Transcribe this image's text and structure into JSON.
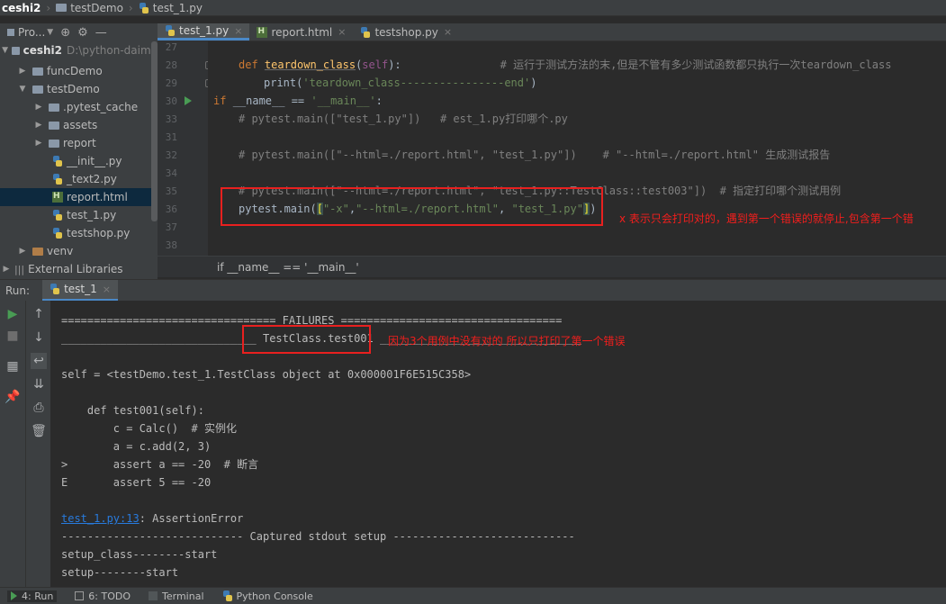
{
  "breadcrumb": {
    "root": "ceshi2",
    "folder": "testDemo",
    "file": "test_1.py"
  },
  "project": {
    "header_label": "Pro...",
    "root_name": "ceshi2",
    "root_path": "D:\\python-daima",
    "items": [
      {
        "label": "funcDemo",
        "type": "folder"
      },
      {
        "label": "testDemo",
        "type": "folder"
      },
      {
        "label": ".pytest_cache",
        "type": "folder"
      },
      {
        "label": "assets",
        "type": "folder"
      },
      {
        "label": "report",
        "type": "folder"
      },
      {
        "label": "__init__.py",
        "type": "py"
      },
      {
        "label": "_text2.py",
        "type": "py"
      },
      {
        "label": "report.html",
        "type": "html"
      },
      {
        "label": "test_1.py",
        "type": "py"
      },
      {
        "label": "testshop.py",
        "type": "py"
      },
      {
        "label": "venv",
        "type": "folder"
      },
      {
        "label": "External Libraries",
        "type": "lib"
      }
    ]
  },
  "tabs": [
    {
      "label": "test_1.py",
      "active": true
    },
    {
      "label": "report.html",
      "active": false
    },
    {
      "label": "testshop.py",
      "active": false
    }
  ],
  "editor": {
    "line_numbers": [
      "27",
      "28",
      "29",
      "30",
      "31",
      "32",
      "33",
      "34",
      "35",
      "36",
      "37",
      "38"
    ],
    "lines": {
      "l28_def": "def ",
      "l28_fn": "teardown_class",
      "l28_open": "(",
      "l28_self": "self",
      "l28_close": "):",
      "l28_comment": "# 运行于测试方法的末,但是不管有多少测试函数都只执行一次teardown_class",
      "l29_print": "print(",
      "l29_str": "'teardown_class----------------end'",
      "l29_close": ")",
      "l30_if": "if ",
      "l30_name": "__name__",
      "l30_eq": " == ",
      "l30_str": "'__main__'",
      "l30_colon": ":",
      "l31": "# pytest.main([\"test_1.py\"])   # est_1.py打印哪个.py",
      "l33": "# pytest.main([\"--html=./report.html\", \"test_1.py\"])    # \"--html=./report.html\" 生成测试报告",
      "l35": "# pytest.main([\"--html=./report.html\", \"test_1.py::TestClass::test003\"])  # 指定打印哪个测试用例",
      "l36_call": "pytest.main(",
      "l36_open": "[",
      "l36_s1": "\"-x\"",
      "l36_c1": ",",
      "l36_s2": "\"--html=./report.html\"",
      "l36_c2": ", ",
      "l36_s3": "\"test_1.py\"",
      "l36_close": "]",
      "l36_end": ")"
    },
    "annotation": "x 表示只会打印对的，遇到第一个错误的就停止,包含第一个错",
    "breadcrumb": "if __name__ == '__main__'"
  },
  "run": {
    "label": "Run:",
    "tab": "test_1",
    "console": [
      "================================= FAILURES ==================================",
      "______________________________ TestClass.test001 _______________________________",
      "",
      "self = <testDemo.test_1.TestClass object at 0x000001F6E515C358>",
      "",
      "    def test001(self):",
      "        c = Calc()  # 实例化",
      "        a = c.add(2, 3)",
      ">       assert a == -20  # 断言",
      "E       assert 5 == -20",
      "",
      "",
      "---------------------------- Captured stdout setup ----------------------------",
      "setup_class--------start",
      "setup--------start"
    ],
    "error_link": "test_1.py:13",
    "error_text": ": AssertionError",
    "annotation": "因为3个用例中没有对的 所以只打印了第一个错误"
  },
  "bottom_bar": {
    "run": "4: Run",
    "todo": "6: TODO",
    "terminal": "Terminal",
    "python_console": "Python Console"
  }
}
